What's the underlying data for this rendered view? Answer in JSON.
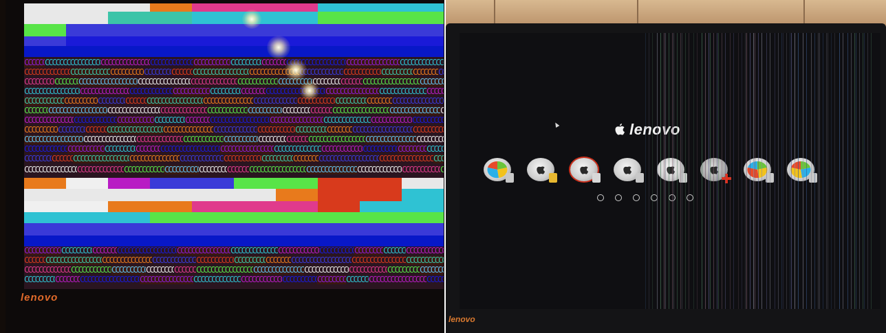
{
  "left_photo": {
    "brand_text": "lenovo"
  },
  "right_photo": {
    "boot_brand_text": "lenovo",
    "boot_tagline": "",
    "boot_label": "",
    "bezel_brand_text": "lenovo",
    "corner_text": ""
  },
  "colors": {
    "glitch_palette": [
      "#e8e8e8",
      "#2fc2d3",
      "#3a3ad8",
      "#58e448",
      "#e03a8c",
      "#d83a1c",
      "#1a1ad8",
      "#b81cc4",
      "#e87a1c",
      "#3cc4a8",
      "#f0f0f0",
      "#8c1cd8",
      "#60c0f0",
      "#0818c8"
    ],
    "bezel_brand": "#e06a2a",
    "boot_text": "#f2f2f2",
    "boot_background": "#0f0f12"
  },
  "icons": [
    "apple-logo-icon",
    "windows-volume-icon",
    "mac-volume-icon",
    "recovery-volume-icon",
    "lock-icon",
    "shutdown-icon",
    "restart-icon"
  ]
}
